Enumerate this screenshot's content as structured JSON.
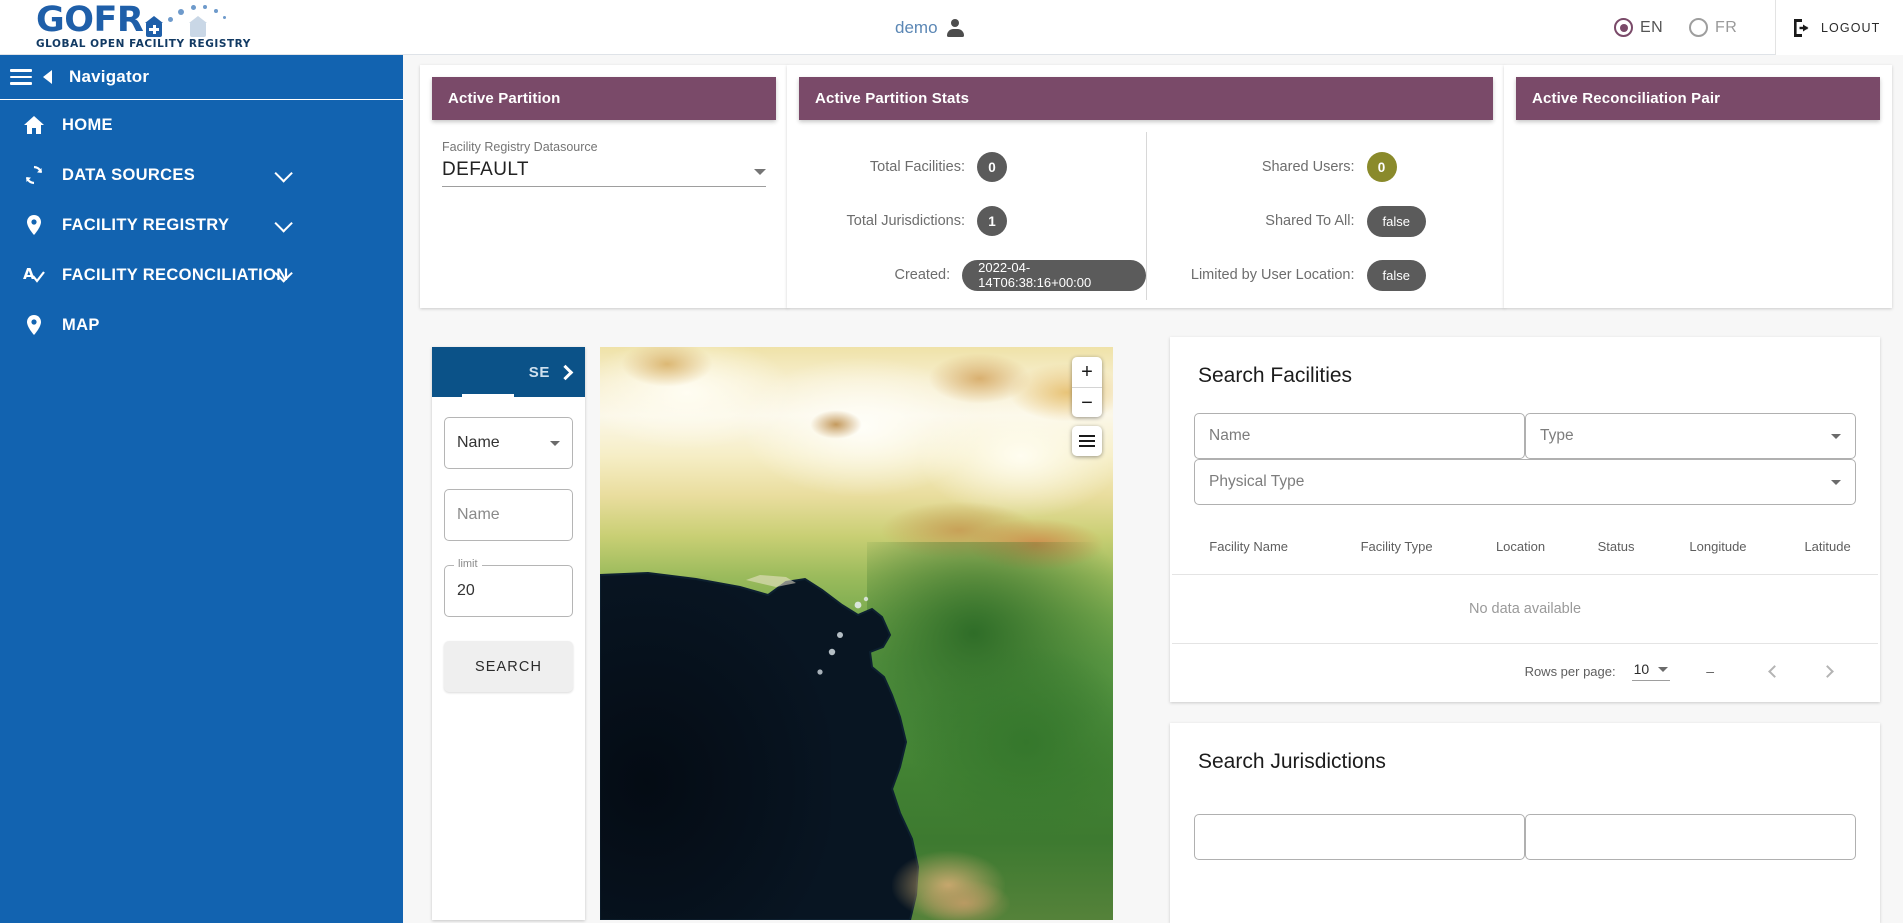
{
  "header": {
    "logo_text": "GOFR",
    "logo_tagline": "GLOBAL OPEN FACILITY REGISTRY",
    "user_name": "demo",
    "user_icon": "person-icon",
    "languages": [
      {
        "code": "EN",
        "selected": true
      },
      {
        "code": "FR",
        "selected": false
      }
    ],
    "logout_label": "LOGOUT",
    "logout_icon": "logout-icon"
  },
  "sidebar": {
    "title": "Navigator",
    "menu_icon": "hamburger-icon",
    "collapse_icon": "caret-left-icon",
    "items": [
      {
        "label": "HOME",
        "icon": "home-icon",
        "expandable": false
      },
      {
        "label": "DATA SOURCES",
        "icon": "sync-icon",
        "expandable": true
      },
      {
        "label": "FACILITY REGISTRY",
        "icon": "map-pin-icon",
        "expandable": true
      },
      {
        "label": "FACILITY RECONCILIATION",
        "icon": "match-check-icon",
        "expandable": true
      },
      {
        "label": "MAP",
        "icon": "map-pin-icon",
        "expandable": false
      }
    ]
  },
  "cards": {
    "partition": {
      "title": "Active Partition",
      "datasource_label": "Facility Registry Datasource",
      "datasource_value": "DEFAULT"
    },
    "stats": {
      "title": "Active Partition Stats",
      "left": [
        {
          "label": "Total Facilities:",
          "value": "0",
          "style": "grey"
        },
        {
          "label": "Total Jurisdictions:",
          "value": "1",
          "style": "grey"
        },
        {
          "label": "Created:",
          "value": "2022-04-14T06:38:16+00:00",
          "style": "grey-wide"
        }
      ],
      "right": [
        {
          "label": "Shared Users:",
          "value": "0",
          "style": "olive"
        },
        {
          "label": "Shared To All:",
          "value": "false",
          "style": "grey-wide"
        },
        {
          "label": "Limited by User Location:",
          "value": "false",
          "style": "grey-wide"
        }
      ]
    },
    "reconciliation": {
      "title": "Active Reconciliation Pair"
    }
  },
  "map_search": {
    "tab_label": "SE",
    "tab_chevron": "chevron-right-icon",
    "type_select_value": "Name",
    "name_placeholder": "Name",
    "limit_legend": "limit",
    "limit_value": "20",
    "search_button": "SEARCH"
  },
  "map": {
    "zoom_in": "+",
    "zoom_out": "−",
    "layers_icon": "layers-icon"
  },
  "facilities": {
    "title": "Search Facilities",
    "name_placeholder": "Name",
    "type_placeholder": "Type",
    "physical_type_placeholder": "Physical Type",
    "columns": [
      "Facility Name",
      "Facility Type",
      "Location",
      "Status",
      "Longitude",
      "Latitude"
    ],
    "empty_text": "No data available",
    "rows_per_page_label": "Rows per page:",
    "rows_per_page_value": "10",
    "page_range": "–",
    "prev_icon": "chevron-left-icon",
    "next_icon": "chevron-right-icon"
  },
  "jurisdictions": {
    "title": "Search Jurisdictions"
  },
  "colors": {
    "sidebar_blue": "#1263b0",
    "card_header_plum": "#7a4a69",
    "tab_blue": "#0b5288",
    "badge_grey": "#5b5b5b",
    "badge_olive": "#8a8a2b",
    "logo_blue": "#1f5fa9"
  }
}
